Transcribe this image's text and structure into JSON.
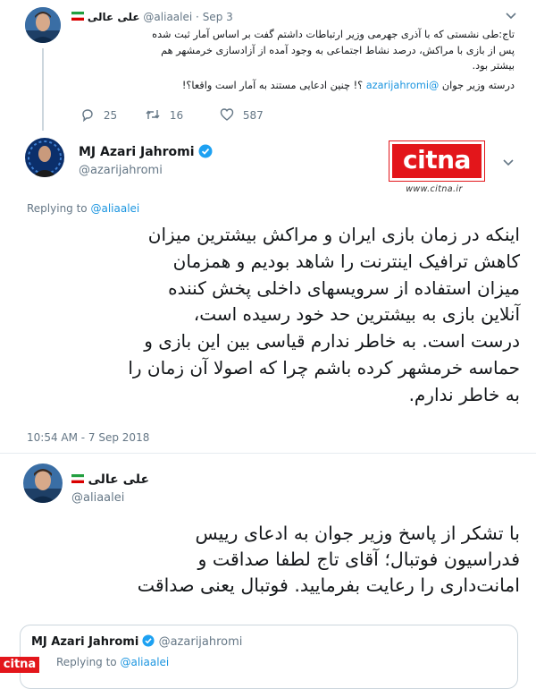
{
  "tweet1": {
    "display_name": "علی عالی",
    "handle": "@aliaalei",
    "dot": "·",
    "date": "Sep 3",
    "lines": [
      "تاج:طی نشستی که با آذری جهرمی وزیر ارتباطات داشتم گفت بر اساس آمار ثبت شده",
      "پس از بازی با مراکش، درصد نشاط اجتماعی به وجود آمده از آزادسازی خرمشهر هم",
      "بیشتر بود."
    ],
    "line4_pre": "درسته وزیر جوان ",
    "line4_mention": "@azarijahromi",
    "line4_post": " ؟! چنین ادعایی مستند به آمار است واقعا؟!",
    "reply_count": "25",
    "retweet_count": "16",
    "like_count": "587"
  },
  "tweet2": {
    "display_name": "MJ Azari Jahromi",
    "handle": "@azarijahromi",
    "replying_to_label": "Replying to ",
    "replying_to_handle": "@aliaalei",
    "body_lines": [
      "اینکه در زمان بازی ایران و مراکش بیشترین میزان",
      "کاهش ترافیک اینترنت را شاهد بودیم و همزمان",
      "میزان استفاده از سرویسهای داخلی پخش کننده",
      "آنلاین بازی به بیشترین حد خود رسیده است،",
      "درست است. به خاطر ندارم قیاسی بین این بازی و",
      "حماسه خرمشهر کرده باشم چرا که اصولا آن زمان را",
      "به خاطر ندارم."
    ],
    "timestamp": "10:54 AM - 7 Sep 2018"
  },
  "watermark": {
    "logo_text": "citna",
    "url": "www.citna.ir"
  },
  "tweet3": {
    "display_name": "علی عالی",
    "handle": "@aliaalei",
    "body_lines": [
      "با تشکر از پاسخ وزیر جوان به ادعای رییس",
      "فدراسیون فوتبال؛ آقای تاج لطفا صداقت و",
      "امانت‌داری را رعایت بفرمایید. فوتبال یعنی صداقت"
    ]
  },
  "quoted": {
    "display_name": "MJ Azari Jahromi",
    "handle": "@azarijahromi",
    "replying_to_label": "Replying to ",
    "replying_to_handle": "@aliaalei"
  },
  "bottom_logo": "citna",
  "colors": {
    "link": "#1b95e0",
    "muted": "#657786",
    "verified": "#1da1f2",
    "citna_red": "#e3161b"
  }
}
